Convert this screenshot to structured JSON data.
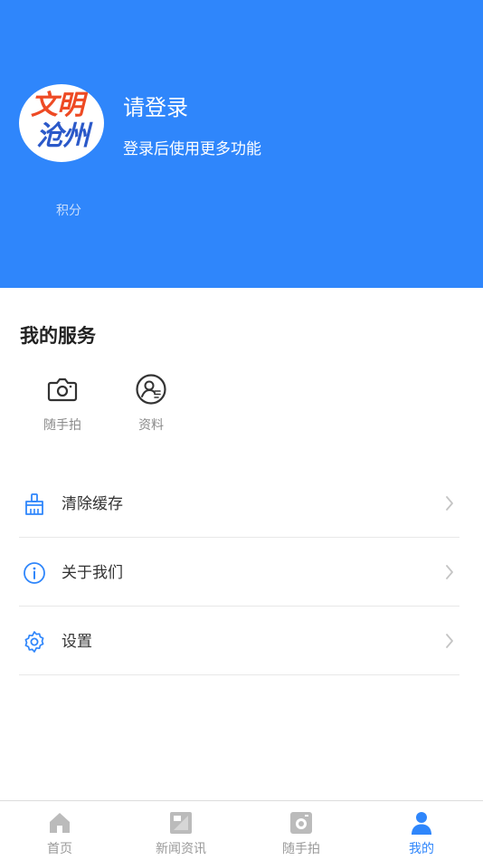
{
  "colors": {
    "primary": "#2f86fb",
    "logo_red": "#ee4a24",
    "logo_blue": "#2b59c9",
    "tab_inactive": "#bbbbbb"
  },
  "header": {
    "logo_line1": "文明",
    "logo_line2": "沧州",
    "login_title": "请登录",
    "login_subtitle": "登录后使用更多功能",
    "points_label": "积分"
  },
  "services": {
    "title": "我的服务",
    "items": [
      {
        "label": "随手拍",
        "icon": "camera-icon"
      },
      {
        "label": "资料",
        "icon": "profile-icon"
      }
    ]
  },
  "menu": [
    {
      "label": "清除缓存",
      "icon": "broom-icon"
    },
    {
      "label": "关于我们",
      "icon": "info-icon"
    },
    {
      "label": "设置",
      "icon": "gear-icon"
    }
  ],
  "tabbar": [
    {
      "label": "首页",
      "icon": "home-icon",
      "active": false
    },
    {
      "label": "新闻资讯",
      "icon": "news-icon",
      "active": false
    },
    {
      "label": "随手拍",
      "icon": "snapshot-icon",
      "active": false
    },
    {
      "label": "我的",
      "icon": "user-icon",
      "active": true
    }
  ]
}
